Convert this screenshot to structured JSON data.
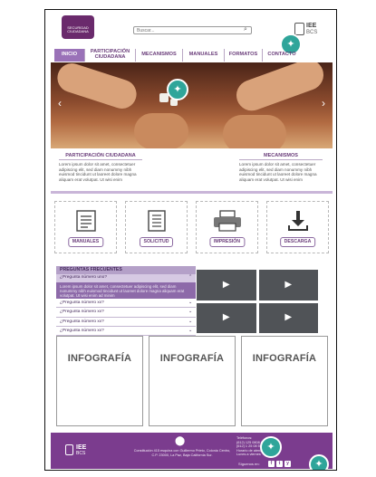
{
  "header": {
    "logo_text": "SECURIDAD CIUDADANA",
    "search_placeholder": "Buscar...",
    "brand": {
      "name": "IEE",
      "sub": "BCS"
    }
  },
  "nav": {
    "items": [
      {
        "label": "INICIO"
      },
      {
        "label": "PARTICIPACIÓN CIUDADANA"
      },
      {
        "label": "MECANISMOS"
      },
      {
        "label": "MANUALES"
      },
      {
        "label": "FORMATOS"
      },
      {
        "label": "CONTACTO"
      }
    ]
  },
  "hero": {
    "prev": "‹",
    "next": "›"
  },
  "sections": {
    "left": {
      "title": "PARTICIPACIÓN CIUDADANA",
      "text": "Lorem ipsum dolor sit amet, consectetuer adipiscing elit, sed diam nonummy nibh euismod tincidunt ut laoreet dolore magna aliquam erat volutpat. Ut wisi enim"
    },
    "right": {
      "title": "MECANISMOS",
      "text": "Lorem ipsum dolor sit amet, consectetuer adipiscing elit, sed diam nonummy nibh euismod tincidunt ut laoreet dolore magna aliquam erat volutpat. Ut wisi enim"
    }
  },
  "tiles": [
    {
      "label": "MANUALES",
      "icon": "manual-icon"
    },
    {
      "label": "SOLICITUD",
      "icon": "document-icon"
    },
    {
      "label": "IMPRESIÓN",
      "icon": "printer-icon"
    },
    {
      "label": "DESCARGA",
      "icon": "download-icon"
    }
  ],
  "faq": {
    "title": "PREGUNTAS FRECUENTES",
    "open_question": "¿Pregunta número uno?",
    "open_answer": "Lorem ipsum dolor sit amet, consectetuer adipiscing elit, sed diam nonummy nibh euismod tincidunt ut laoreet dolore magna aliquam erat volutpat. Ut wisi enim ad minim",
    "questions": [
      "¿Pregunta número xx?",
      "¿Pregunta número xx?",
      "¿Pregunta número xx?",
      "¿Pregunta número xx?"
    ]
  },
  "videos": [
    {
      "icon": "play-icon"
    },
    {
      "icon": "play-icon"
    },
    {
      "icon": "play-icon"
    },
    {
      "icon": "play-icon"
    }
  ],
  "infographics": [
    "INFOGRAFÍA",
    "INFOGRAFÍA",
    "INFOGRAFÍA"
  ],
  "footer": {
    "brand": "IEE",
    "brand_sub": "BCS",
    "address": "Constitución 415 esquina con Guillermo Prieto, Colonia Centro, C.P. 23000, La Paz, Baja California Sur.",
    "contact_lines": [
      "Teléfonos:",
      "(612) 125 0808 / 12 25 62",
      "(612) 1 25 08 59",
      "Horario de atención:",
      "Lunes a viernes"
    ],
    "follow": "Síguenos en:",
    "social": [
      "f",
      "t",
      "y"
    ]
  },
  "colors": {
    "accent": "#7b3c8e",
    "nav_active": "#9a72b8",
    "pin": "#2fa59a"
  }
}
